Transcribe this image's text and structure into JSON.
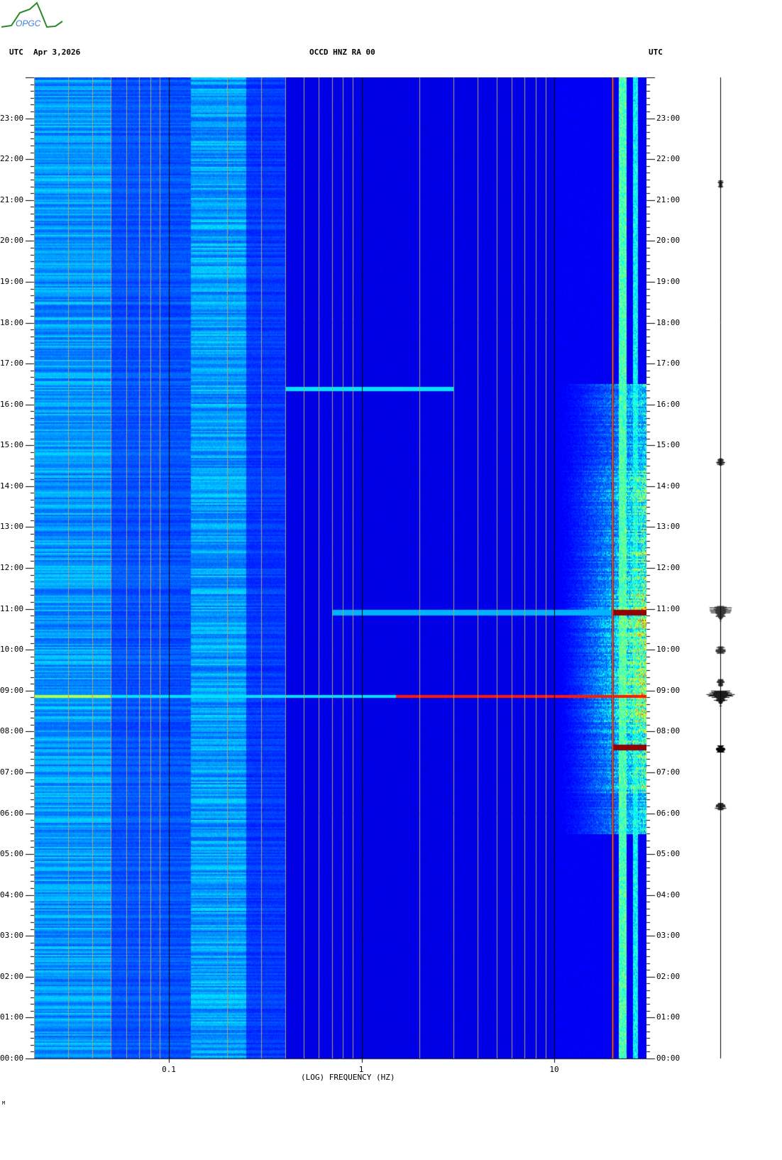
{
  "header": {
    "logo_text": "OPGC",
    "left_tz": "UTC",
    "date": "Apr 3,2026",
    "station": "OCCD HNZ RA 00",
    "right_tz": "UTC"
  },
  "footer_mark": "M",
  "chart_data": {
    "type": "heatmap",
    "title": "OCCD HNZ RA 00",
    "xlabel": "(LOG) FREQUENCY (HZ)",
    "ylabel": "UTC",
    "xscale": "log",
    "xlim": [
      0.02,
      30
    ],
    "ylim_hours": [
      0,
      24
    ],
    "x_tick_labels": [
      {
        "value": 0.1,
        "label": "0.1"
      },
      {
        "value": 1,
        "label": "1"
      },
      {
        "value": 10,
        "label": "10"
      }
    ],
    "y_tick_labels": [
      "00:00",
      "01:00",
      "02:00",
      "03:00",
      "04:00",
      "05:00",
      "06:00",
      "07:00",
      "08:00",
      "09:00",
      "10:00",
      "11:00",
      "12:00",
      "13:00",
      "14:00",
      "15:00",
      "16:00",
      "17:00",
      "18:00",
      "19:00",
      "20:00",
      "21:00",
      "22:00",
      "23:00"
    ],
    "colormap": "jet",
    "features": [
      {
        "kind": "horizontal_line",
        "time_h": 8.85,
        "fmin": 0.02,
        "fmax": 30,
        "intensity": "high above 1.5 Hz"
      },
      {
        "kind": "horizontal_line",
        "time_h": 16.38,
        "fmin": 0.4,
        "fmax": 3,
        "intensity": "medium"
      },
      {
        "kind": "constant_tone",
        "freq_hz": 20,
        "intensity": "high"
      },
      {
        "kind": "broadband_activity",
        "time_h": [
          5.5,
          16.5
        ],
        "fmin": 10,
        "fmax": 30,
        "intensity": "high"
      },
      {
        "kind": "event",
        "time_h": 10.9,
        "fmin": 0.7,
        "fmax": 30
      },
      {
        "kind": "event",
        "time_h": 7.6,
        "fmin": 20,
        "fmax": 30
      }
    ],
    "seismogram_events_h": [
      10.92,
      10.0,
      9.2,
      8.85,
      7.58,
      6.17,
      14.6,
      21.4
    ]
  }
}
